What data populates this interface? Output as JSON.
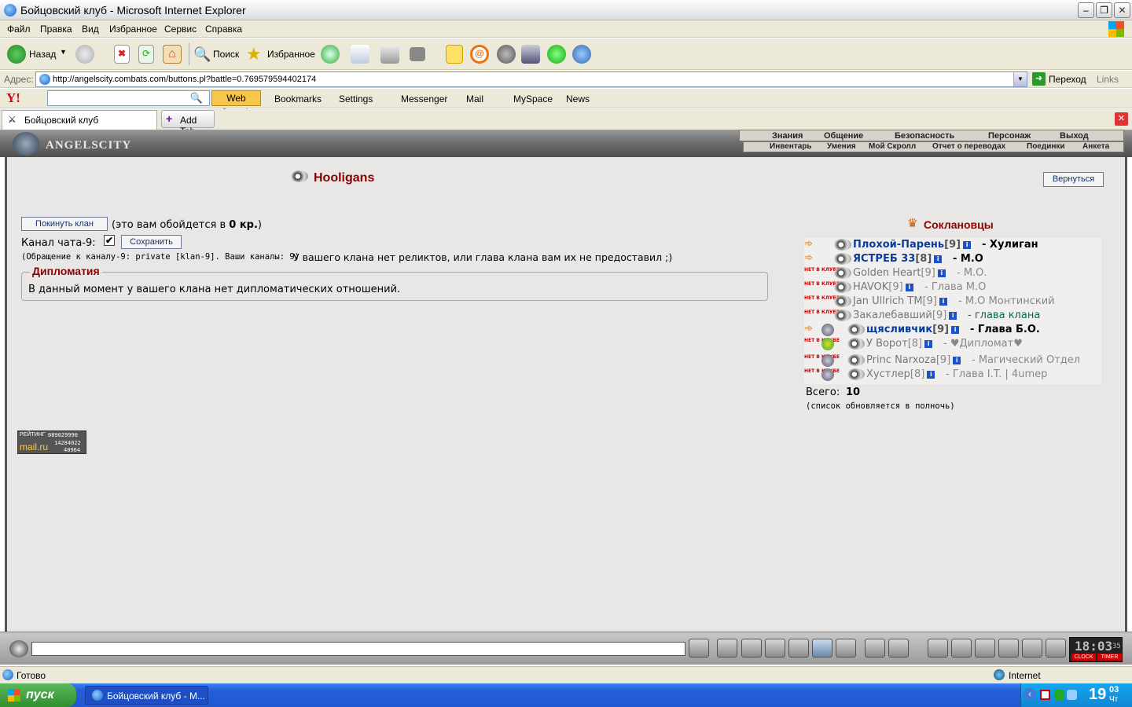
{
  "window": {
    "title": "Бойцовский клуб - Microsoft Internet Explorer"
  },
  "menu": [
    "Файл",
    "Правка",
    "Вид",
    "Избранное",
    "Сервис",
    "Справка"
  ],
  "toolbar": {
    "back_label": "Назад",
    "search_label": "Поиск",
    "favorites_label": "Избранное"
  },
  "address": {
    "label": "Адрес:",
    "url": "http://angelscity.combats.com/buttons.pl?battle=0.769579594402174",
    "go_label": "Переход",
    "links_label": "Links"
  },
  "yahoo": {
    "logo": "Y!",
    "web_search": "Web Search",
    "bookmarks": "Bookmarks",
    "settings": "Settings",
    "messenger": "Messenger",
    "mail": "Mail",
    "myspace": "MySpace",
    "news": "News"
  },
  "tabs": {
    "active": "Бойцовский клуб",
    "add": "Add Tab"
  },
  "game": {
    "logo": "ANGELSCITY",
    "nav_top": [
      "Знания",
      "Общение",
      "Безопасность",
      "Персонаж",
      "Выход"
    ],
    "nav_bottom": [
      "Инвентарь",
      "Умения",
      "Мой Скролл",
      "Отчет о переводах",
      "Поединки",
      "Анкета"
    ]
  },
  "clan": {
    "name": "Hooligans",
    "back_button": "Вернуться",
    "leave_button": "Покинуть клан",
    "leave_cost_pre": "(это вам обойдется в ",
    "leave_cost_val": "0 кр.",
    "leave_cost_post": ")",
    "chat_label": "Канал чата-9:",
    "save_button": "Сохранить",
    "channel_note": "(Обращение к каналу-9: private [klan-9]. Ваши каналы: 9)",
    "relics_note": "У вашего клана нет реликтов, или глава клана вам их не предоставил ;)",
    "diplomacy_title": "Дипломатия",
    "diplomacy_text": "В данный момент у вашего клана нет дипломатических отношений.",
    "members_title": "Соклановцы",
    "total_label": "Всего:",
    "total_value": "10",
    "update_note": "(список обновляется в полночь)",
    "members": [
      {
        "status": "online",
        "name": "Плохой-Парень",
        "level": "[9]",
        "rank": "- Хулиган"
      },
      {
        "status": "online",
        "name": "ЯСТРЕБ 33",
        "level": "[8]",
        "rank": "- М.О"
      },
      {
        "status": "offline",
        "name": "Golden Heart",
        "level": "[9]",
        "rank": "- М.О."
      },
      {
        "status": "offline",
        "name": "HAVOK",
        "level": "[9]",
        "rank": "- Глава М.О"
      },
      {
        "status": "offline",
        "name": "Jan Ullrich TM",
        "level": "[9]",
        "rank": "- М.О Монтинский"
      },
      {
        "status": "offline",
        "name": "Закалебавший",
        "level": "[9]",
        "rank": "- глава клана"
      },
      {
        "status": "online",
        "name": "щясливчик",
        "level": "[9]",
        "rank": "- Глава Б.О."
      },
      {
        "status": "offline",
        "name": "У Ворот",
        "level": "[8]",
        "rank": "- ♥Дипломат♥"
      },
      {
        "status": "offline",
        "name": "Princ Narxoza",
        "level": "[9]",
        "rank": "- Магический Отдел"
      },
      {
        "status": "offline",
        "name": "Хустлер",
        "level": "[8]",
        "rank": "- Глава I.T. | 4umep"
      }
    ],
    "offline_badge": "НЕТ В КЛУБЕ"
  },
  "counter": {
    "line1": "РЕЙТИНГ",
    "num1": "089029990",
    "brand": "mail.ru",
    "num2": "14284022",
    "num3": "40964"
  },
  "clock": {
    "time": "18:03",
    "sec": "35",
    "clock_label": "CLOCK",
    "timer_label": "TIMER"
  },
  "status": {
    "text": "Готово",
    "zone": "Internet"
  },
  "taskbar": {
    "start": "пуск",
    "task": "Бойцовский клуб - М...",
    "time": "19",
    "time_min": "03",
    "day": "Чт"
  },
  "colors": {
    "clan_title": "#8b0000",
    "online_name": "#0b3c99",
    "offline_name": "#777777",
    "accent_yellow": "#f7c64a"
  }
}
